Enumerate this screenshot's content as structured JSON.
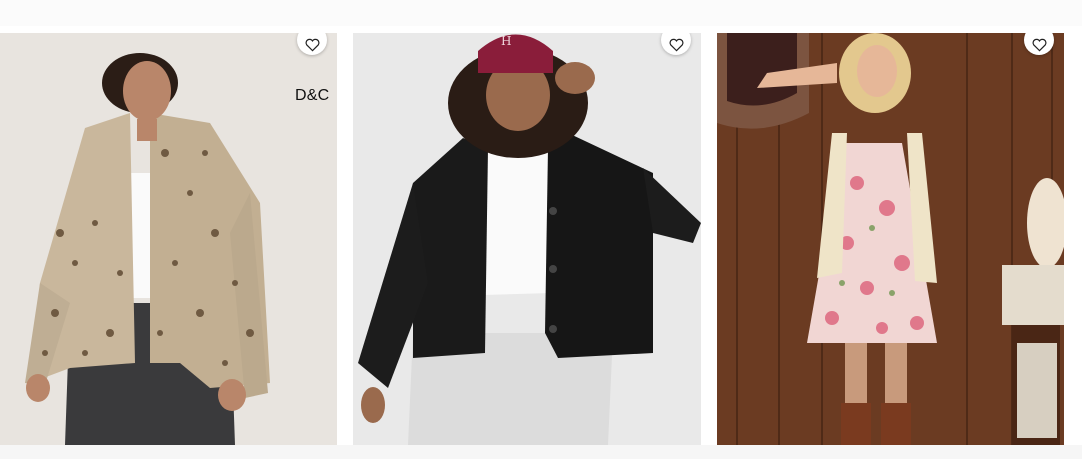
{
  "products": [
    {
      "image_subject": "leopard-print-denim-jacket-photo",
      "brand_tag": "D&C",
      "favorite_icon": "heart-outline-icon",
      "colors": {
        "backdrop": "#e8e4df",
        "jacket": "#c9b79c",
        "spots": "#6f5a42"
      }
    },
    {
      "image_subject": "black-sherpa-jacket-photo",
      "favorite_icon": "heart-outline-icon",
      "colors": {
        "backdrop": "#e9e9e9",
        "jacket": "#1a1a1a",
        "cap": "#8a1d3a"
      }
    },
    {
      "image_subject": "floral-mini-dress-photo",
      "favorite_icon": "heart-outline-icon",
      "colors": {
        "backdrop": "#6b3b22",
        "dress": "#f1d6d3",
        "flowers": "#e0788b"
      }
    }
  ]
}
